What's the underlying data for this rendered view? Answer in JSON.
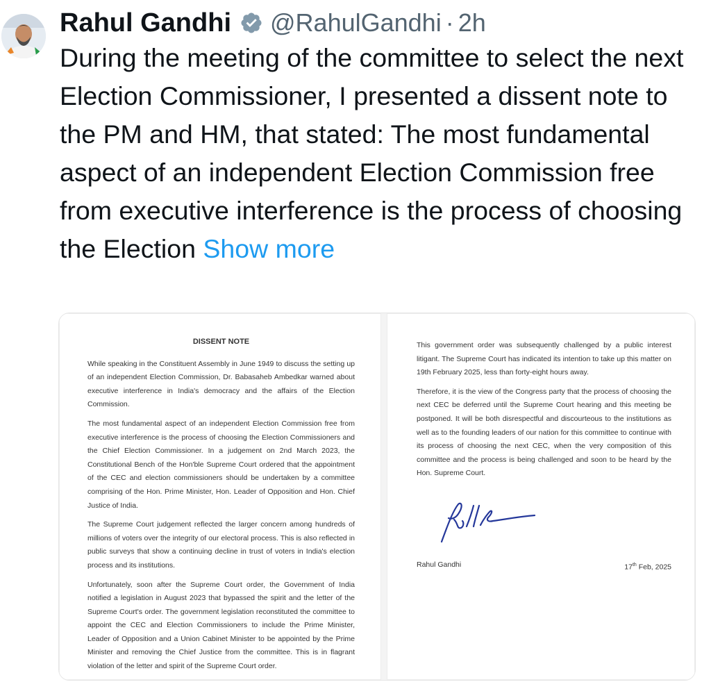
{
  "tweet": {
    "author_name": "Rahul Gandhi",
    "handle": "@RahulGandhi",
    "separator": "·",
    "time": "2h",
    "text": "During the meeting of the committee to select the next Election Commissioner, I presented a dissent note to the PM and HM, that stated: The most fundamental aspect of an independent Election Commission free from executive interference is the process of choosing the Election ",
    "show_more": "Show more",
    "accent_color": "#1d9bf0",
    "verified_icon": "verified-badge-icon"
  },
  "document": {
    "page1": {
      "title": "DISSENT NOTE",
      "paragraphs": [
        "While speaking in the Constituent Assembly in June 1949 to discuss the setting up of an independent Election Commission, Dr. Babasaheb Ambedkar warned about executive interference in India's democracy and the affairs of the Election Commission.",
        "The most fundamental aspect of an independent Election Commission free from executive interference is the process of choosing the Election Commissioners and the Chief Election Commissioner. In a judgement on 2nd March 2023, the Constitutional Bench of the Hon'ble Supreme Court ordered that the appointment of the CEC and election commissioners should be undertaken by a committee comprising of the Hon. Prime Minister, Hon. Leader of Opposition and Hon. Chief Justice of India.",
        "The Supreme Court judgement reflected the larger concern among hundreds of millions of voters over the integrity of our electoral process. This is also reflected in public surveys that show a continuing decline in trust of voters in India's election process and its institutions.",
        "Unfortunately, soon after the Supreme Court order, the Government of India notified a legislation in August 2023 that bypassed the spirit and the letter of the Supreme Court's order. The government legislation reconstituted the committee to appoint the CEC and Election Commissioners to include the Prime Minister, Leader of Opposition and a Union Cabinet Minister to be appointed by the Prime Minister and removing the Chief Justice from the committee. This is in flagrant violation of the letter and spirit of the Supreme Court order."
      ]
    },
    "page2": {
      "paragraphs": [
        "This government order was subsequently challenged by a public interest litigant. The Supreme Court has indicated its intention to take up this matter on 19th February 2025, less than forty-eight hours away.",
        "Therefore, it is the view of the Congress party that the process of choosing the next CEC be deferred until the Supreme Court hearing and this meeting be postponed. It will be both disrespectful and discourteous to the institutions as well as to the founding leaders of our nation for this committee to continue with its process of choosing the next CEC, when the very composition of this committee and the process is being challenged and soon to be heard by the Hon. Supreme Court."
      ],
      "signature_name": "Rahul Gandhi",
      "date_day": "17",
      "date_suffix": "th",
      "date_rest": " Feb, 2025"
    }
  }
}
